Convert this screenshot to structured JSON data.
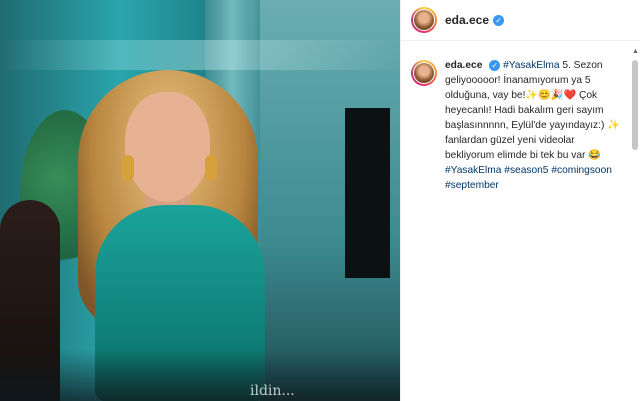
{
  "post": {
    "username": "eda.ece",
    "caption_intro": "5. Sezon geliyooooor! İnanamıyorum ya 5 olduğuna, vay be!✨😊🎉❤️ Çok heyecanlı! Hadi bakalım geri sayım başlasınnnnn, Eylül'de yayındayız:) ✨ fanlardan güzel yeni videolar bekliyorum elimde bi tek bu var 😂",
    "hashtag_first": "#YasakElma",
    "hashtags_end": [
      "#YasakElma",
      "#season5",
      "#comingsoon",
      "#september"
    ]
  },
  "media": {
    "video_caption_fragment": "ildin..."
  },
  "colors": {
    "accent_link": "#00376b",
    "verified": "#3897f0"
  }
}
